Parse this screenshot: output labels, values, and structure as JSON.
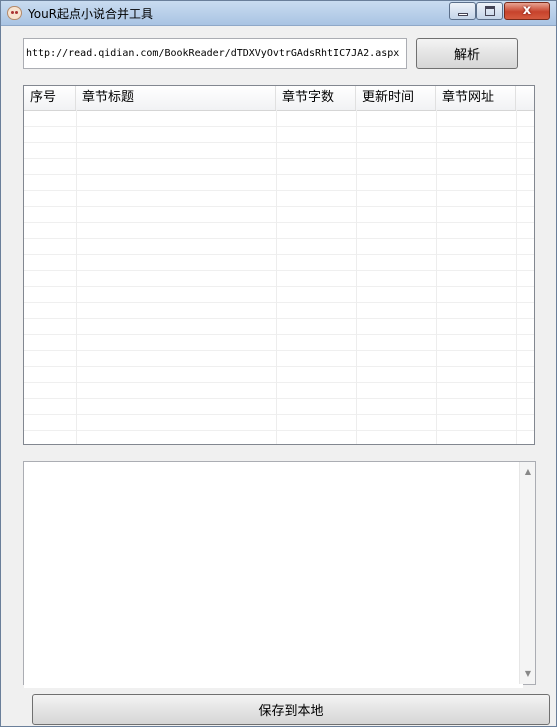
{
  "window": {
    "title": "YouR起点小说合并工具",
    "close_glyph": "x"
  },
  "url_input": {
    "value": "http://read.qidian.com/BookReader/dTDXVyOvtrGAdsRhtIC7JA2.aspx"
  },
  "parse_button": {
    "label": "解析"
  },
  "chapter_list": {
    "columns": [
      "序号",
      "章节标题",
      "章节字数",
      "更新时间",
      "章节网址"
    ],
    "rows": []
  },
  "log_area": {
    "text": ""
  },
  "save_button": {
    "label": "保存到本地"
  }
}
